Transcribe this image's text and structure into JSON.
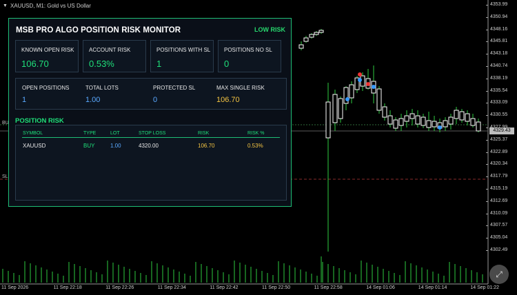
{
  "chart": {
    "symbol_line": "XAUUSD, M1:  Gold vs US Dollar",
    "side_labels": [
      "BU",
      "SL"
    ],
    "current_price": "4329.43",
    "y_ticks": [
      "4353.99",
      "4350.94",
      "4348.16",
      "4345.81",
      "4343.18",
      "4340.74",
      "4338.19",
      "4335.54",
      "4333.09",
      "4330.55",
      "4327.99",
      "4325.37",
      "4322.89",
      "4320.34",
      "4317.79",
      "4315.19",
      "4312.69",
      "4310.09",
      "4307.57",
      "4305.04",
      "4302.49"
    ],
    "x_ticks": [
      "11 Sep 2026",
      "11 Sep 22:18",
      "11 Sep 22:26",
      "11 Sep 22:34",
      "11 Sep 22:42",
      "11 Sep 22:50",
      "11 Sep 22:58",
      "14 Sep 01:06",
      "14 Sep 01:14",
      "14 Sep 01:22"
    ],
    "colors": {
      "up": "#ffffff",
      "down": "#ffffff",
      "wick": "#2ecc40",
      "volume": "#2ecc40",
      "buy_line": "#2f6b3a",
      "sl_line": "#8a2a2a"
    }
  },
  "panel": {
    "title": "MSB PRO ALGO POSITION RISK MONITOR",
    "risk_level": "LOW RISK",
    "cards": [
      {
        "label": "KNOWN OPEN RISK",
        "value": "106.70"
      },
      {
        "label": "ACCOUNT RISK",
        "value": "0.53%"
      },
      {
        "label": "POSITIONS WITH SL",
        "value": "1"
      },
      {
        "label": "POSITIONS NO SL",
        "value": "0"
      }
    ],
    "summary": [
      {
        "label": "OPEN POSITIONS",
        "value": "1",
        "color": "#5aa9ff"
      },
      {
        "label": "TOTAL LOTS",
        "value": "1.00",
        "color": "#5aa9ff"
      },
      {
        "label": "PROTECTED SL",
        "value": "0",
        "color": "#5aa9ff"
      },
      {
        "label": "MAX SINGLE RISK",
        "value": "106.70",
        "color": "#f5c542"
      }
    ],
    "section_title": "POSITION RISK",
    "table": {
      "headers": [
        "SYMBOL",
        "TYPE",
        "LOT",
        "STOP LOSS",
        "RISK",
        "RISK %"
      ],
      "rows": [
        [
          "XAUUSD",
          "BUY",
          "1.00",
          "4320.00",
          "106.70",
          "0.53%"
        ]
      ]
    }
  }
}
